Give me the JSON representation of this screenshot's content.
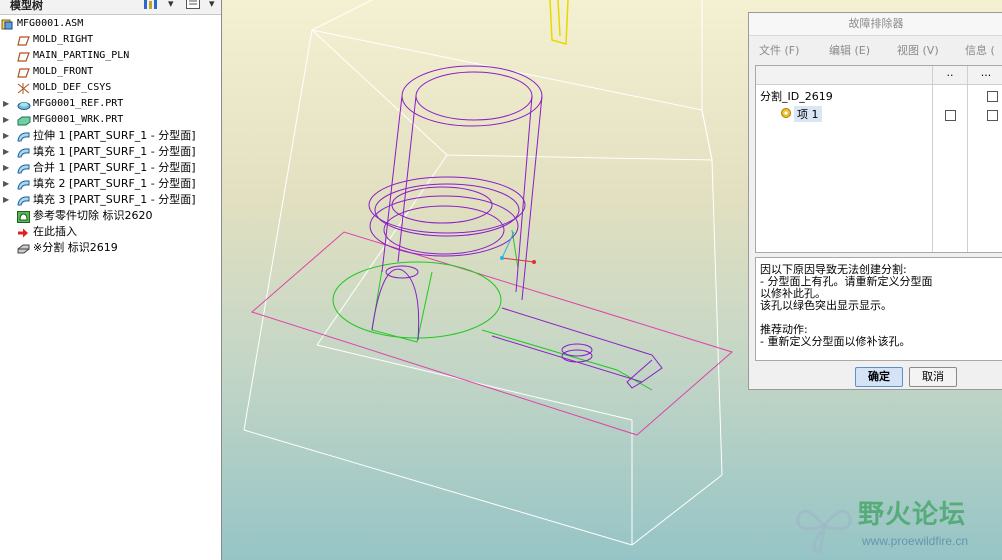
{
  "tree": {
    "title": "模型树",
    "items": [
      {
        "toggle": "",
        "icon": "assembly-icon",
        "label": "MFG0001.ASM",
        "cjk": false
      },
      {
        "toggle": "",
        "icon": "datum-plane-icon",
        "label": "MOLD_RIGHT",
        "cjk": false
      },
      {
        "toggle": "",
        "icon": "datum-plane-icon",
        "label": "MAIN_PARTING_PLN",
        "cjk": false
      },
      {
        "toggle": "",
        "icon": "datum-plane-icon",
        "label": "MOLD_FRONT",
        "cjk": false
      },
      {
        "toggle": "",
        "icon": "coordinate-system-icon",
        "label": "MOLD_DEF_CSYS",
        "cjk": false
      },
      {
        "toggle": "▶",
        "icon": "part-icon",
        "label": "MFG0001_REF.PRT",
        "cjk": false
      },
      {
        "toggle": "▶",
        "icon": "workpiece-icon",
        "label": "MFG0001_WRK.PRT",
        "cjk": false
      },
      {
        "toggle": "▶",
        "icon": "surface-icon",
        "label": "拉伸 1 [PART_SURF_1 - 分型面]",
        "cjk": true
      },
      {
        "toggle": "▶",
        "icon": "surface-icon",
        "label": "填充 1 [PART_SURF_1 - 分型面]",
        "cjk": true
      },
      {
        "toggle": "▶",
        "icon": "surface-icon",
        "label": "合并 1 [PART_SURF_1 - 分型面]",
        "cjk": true
      },
      {
        "toggle": "▶",
        "icon": "surface-icon",
        "label": "填充 2 [PART_SURF_1 - 分型面]",
        "cjk": true
      },
      {
        "toggle": "▶",
        "icon": "surface-icon",
        "label": "填充 3 [PART_SURF_1 - 分型面]",
        "cjk": true
      },
      {
        "toggle": "",
        "icon": "cut-icon",
        "label": "参考零件切除 标识2620",
        "cjk": true
      },
      {
        "toggle": "",
        "icon": "insert-here-arrow-icon",
        "label": "在此插入",
        "cjk": true
      },
      {
        "toggle": "",
        "icon": "split-icon",
        "label": "※分割 标识2619",
        "cjk": true
      }
    ]
  },
  "dialog": {
    "title": "故障排除器",
    "menu": [
      "文件 (F)",
      "编辑 (E)",
      "视图 (V)",
      "信息 ("
    ],
    "columns": [
      "..",
      "..."
    ],
    "root_item": "分割_ID_2619",
    "child_item": "项 1",
    "messages": [
      "因以下原因导致无法创建分割:",
      "  -  分型面上有孔。请重新定义分型面",
      "以修补此孔。",
      "该孔以绿色突出显示显示。",
      "",
      "推荐动作:",
      "-  重新定义分型面以修补该孔。"
    ],
    "ok_label": "确定",
    "cancel_label": "取消"
  },
  "watermark": {
    "title": "野火论坛",
    "url": "www.proewildfire.cn"
  },
  "colors": {
    "part_outline": "#8a1cc8",
    "parting_surface": "#e040a8",
    "hole_highlight": "#22c822",
    "workpiece_edges": "#ffffff",
    "datum": "#e8d800"
  }
}
